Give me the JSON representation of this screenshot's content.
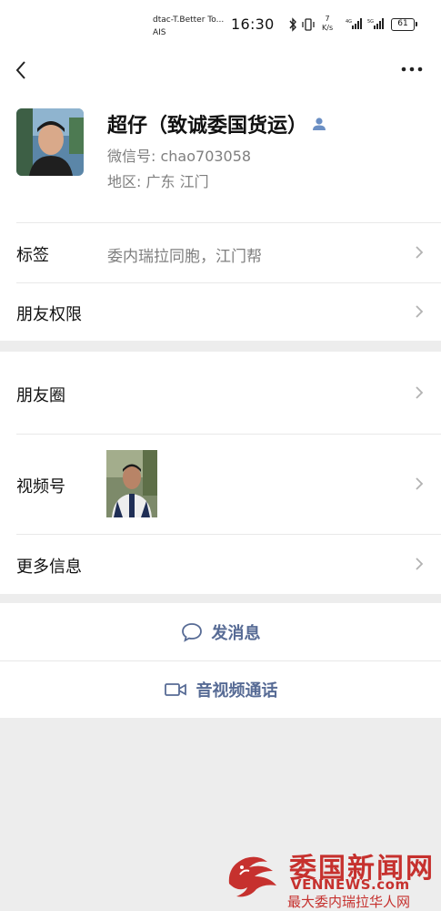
{
  "status_bar": {
    "carrier_line1": "dtac-T.Better To...",
    "carrier_line2": "AIS",
    "time": "16:30",
    "speed_value": "7",
    "speed_unit": "K/s",
    "battery": "61"
  },
  "profile": {
    "name": "超仔（致诚委国货运）",
    "wechat_id": "微信号: chao703058",
    "region": "地区:  广东  江门"
  },
  "rows": {
    "tags_label": "标签",
    "tags_value": "委内瑞拉同胞，江门帮",
    "permissions_label": "朋友权限",
    "moments_label": "朋友圈",
    "channels_label": "视频号",
    "more_info_label": "更多信息"
  },
  "actions": {
    "send_message": "发消息",
    "video_call": "音视频通话"
  },
  "watermark": {
    "title": "委国新闻网",
    "url": "VENNEWS.com",
    "subtitle": "最大委内瑞拉华人网"
  },
  "colors": {
    "link_blue": "#576b95",
    "watermark_red": "#c6312e",
    "background": "#ededed"
  }
}
